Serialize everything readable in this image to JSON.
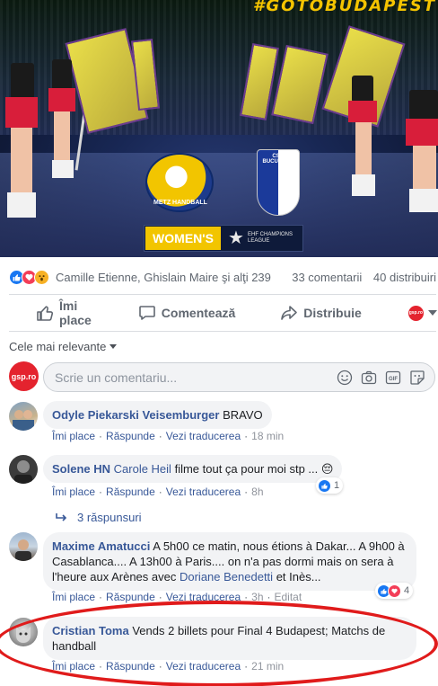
{
  "hero": {
    "hashtag": "#GOTOBUDAPEST",
    "metz_logo_text": "METZ HANDBALL",
    "csm_logo_text": "CSM BUCURESTI",
    "banner_women": "WOMEN'S",
    "banner_league": "EHF CHAMPIONS LEAGUE"
  },
  "reactions": {
    "icons": [
      "like-icon",
      "love-icon",
      "wow-icon"
    ],
    "names": "Camille Etienne, Ghislain Maire şi alţi 239",
    "comments_count": "33 comentarii",
    "shares_count": "40 distribuiri"
  },
  "actions": {
    "like": "Îmi place",
    "comment": "Comentează",
    "share": "Distribuie",
    "page_avatar": "gsp.ro"
  },
  "sort_label": "Cele mai relevante",
  "composer": {
    "avatar": "gsp.ro",
    "placeholder": "Scrie un comentariu..."
  },
  "comments": [
    {
      "author": "Odyle Piekarski Veisemburger",
      "text": "BRAVO",
      "like": "Îmi place",
      "reply": "Răspunde",
      "translate": "Vezi traducerea",
      "time": "18 min"
    },
    {
      "author": "Solene HN",
      "mention": "Carole Heil",
      "text": "filme tout ça pour moi stp ... 😔",
      "like": "Îmi place",
      "reply": "Răspunde",
      "translate": "Vezi traducerea",
      "time": "8h",
      "reaction_count": "1",
      "replies": "3 răspunsuri"
    },
    {
      "author": "Maxime Amatucci",
      "text_1": "A 5h00 ce matin, nous étions à Dakar... A 9h00 à Casablanca.... A 13h00 à Paris.... on n'a pas dormi mais on sera à l'heure aux Arènes avec",
      "mention": "Doriane Benedetti",
      "text_2": "et Inès...",
      "like": "Îmi place",
      "reply": "Răspunde",
      "translate": "Vezi traducerea",
      "time": "3h",
      "edited": "Editat",
      "reaction_count": "4"
    },
    {
      "author": "Cristian Toma",
      "text": "Vends 2 billets pour Final 4 Budapest; Matchs de handball",
      "like": "Îmi place",
      "reply": "Răspunde",
      "translate": "Vezi traducerea",
      "time": "21 min"
    }
  ],
  "colors": {
    "link": "#385898",
    "like_blue": "#1877f2",
    "love_red": "#f33e58",
    "highlight_red": "#e01b1b"
  }
}
